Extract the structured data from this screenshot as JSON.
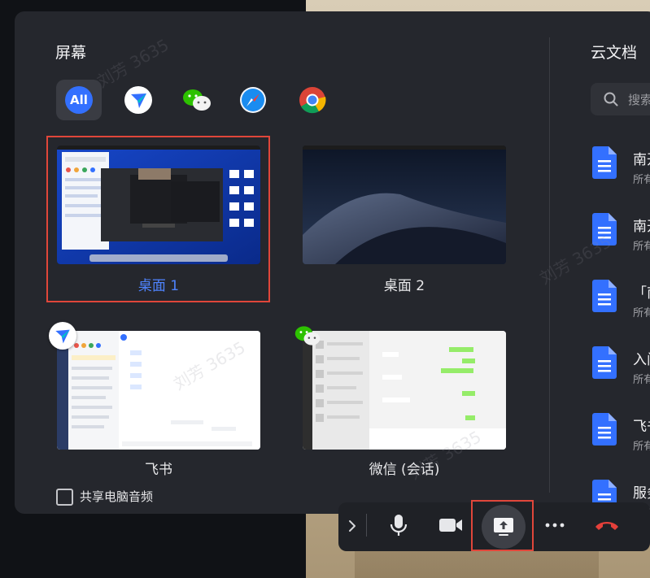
{
  "screens_section": {
    "title": "屏幕"
  },
  "docs_section": {
    "title": "云文档"
  },
  "filters": [
    {
      "name": "all",
      "label": "All"
    },
    {
      "name": "feishu",
      "icon": "feishu-icon"
    },
    {
      "name": "wechat",
      "icon": "wechat-icon"
    },
    {
      "name": "safari",
      "icon": "safari-icon"
    },
    {
      "name": "chrome",
      "icon": "chrome-icon"
    }
  ],
  "tiles": [
    {
      "label": "桌面 1",
      "selected": true
    },
    {
      "label": "桌面 2",
      "selected": false
    },
    {
      "label": "飞书",
      "selected": false
    },
    {
      "label": "微信 (会话)",
      "selected": false
    }
  ],
  "share_audio": {
    "label": "共享电脑音频",
    "checked": false
  },
  "search": {
    "placeholder": "搜索"
  },
  "docs": [
    {
      "title": "南开",
      "sub": "所有"
    },
    {
      "title": "南开",
      "sub": "所有"
    },
    {
      "title": "「南",
      "sub": "所有"
    },
    {
      "title": "入门",
      "sub": "所有"
    },
    {
      "title": "飞书",
      "sub": "所有"
    },
    {
      "title": "服务",
      "sub": "所有"
    }
  ],
  "watermark_text": "刘芳 3635",
  "colors": {
    "accent": "#3370ff",
    "selected_border": "#e0463a",
    "hangup": "#e5403a"
  }
}
